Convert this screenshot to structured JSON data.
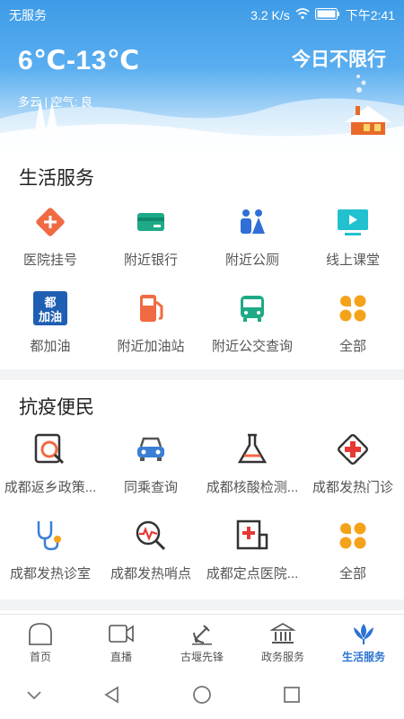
{
  "status_bar": {
    "carrier": "无服务",
    "speed": "3.2 K/s",
    "time": "下午2:41"
  },
  "weather": {
    "temperature": "6℃-13℃",
    "restriction": "今日不限行",
    "description": "多云 | 空气: 良"
  },
  "life_services": {
    "title": "生活服务",
    "items": [
      {
        "label": "医院挂号",
        "icon": "hospital-icon"
      },
      {
        "label": "附近银行",
        "icon": "bank-card-icon"
      },
      {
        "label": "附近公厕",
        "icon": "toilet-icon"
      },
      {
        "label": "线上课堂",
        "icon": "online-class-icon"
      },
      {
        "label": "都加油",
        "icon": "du-refuel-icon"
      },
      {
        "label": "附近加油站",
        "icon": "gas-station-icon"
      },
      {
        "label": "附近公交查询",
        "icon": "bus-icon"
      },
      {
        "label": "全部",
        "icon": "all-icon"
      }
    ]
  },
  "epidemic_services": {
    "title": "抗疫便民",
    "items": [
      {
        "label": "成都返乡政策...",
        "icon": "policy-search-icon"
      },
      {
        "label": "同乘查询",
        "icon": "car-icon"
      },
      {
        "label": "成都核酸检测...",
        "icon": "flask-icon"
      },
      {
        "label": "成都发热门诊",
        "icon": "medical-cross-icon"
      },
      {
        "label": "成都发热诊室",
        "icon": "stethoscope-icon"
      },
      {
        "label": "成都发热哨点",
        "icon": "pulse-search-icon"
      },
      {
        "label": "成都定点医院...",
        "icon": "hospital-building-icon"
      },
      {
        "label": "全部",
        "icon": "all-icon"
      }
    ]
  },
  "tabbar": {
    "items": [
      {
        "label": "首页",
        "icon": "home-icon"
      },
      {
        "label": "直播",
        "icon": "video-icon"
      },
      {
        "label": "古堰先锋",
        "icon": "party-icon"
      },
      {
        "label": "政务服务",
        "icon": "government-icon"
      },
      {
        "label": "生活服务",
        "icon": "lotus-icon"
      }
    ],
    "active_index": 4
  },
  "colors": {
    "accent": "#2c73d2",
    "header_top": "#3d9be6"
  }
}
